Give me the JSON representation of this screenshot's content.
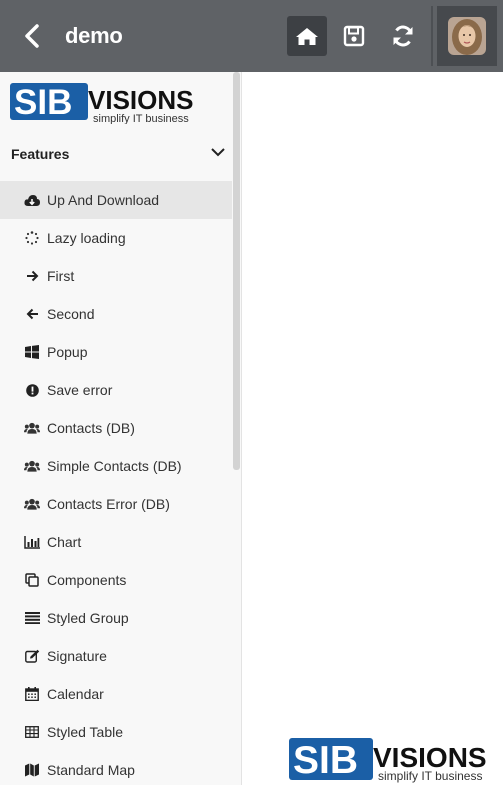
{
  "header": {
    "title": "demo",
    "back_icon": "chevron-left-icon",
    "home_icon": "home-icon",
    "save_icon": "floppy-disk-icon",
    "reload_icon": "refresh-icon",
    "avatar": "user-avatar"
  },
  "brand": {
    "name_left": "SIB",
    "name_right": "VISIONS",
    "tagline": "simplify IT business",
    "color": "#1b5fa6"
  },
  "sidebar": {
    "group_title": "Features",
    "items": [
      {
        "label": "Up And Download",
        "icon": "cloud-download-icon",
        "active": true
      },
      {
        "label": "Lazy loading",
        "icon": "spinner-icon"
      },
      {
        "label": "First",
        "icon": "arrow-right-icon"
      },
      {
        "label": "Second",
        "icon": "arrow-left-icon"
      },
      {
        "label": "Popup",
        "icon": "windows-icon"
      },
      {
        "label": "Save error",
        "icon": "exclamation-circle-icon"
      },
      {
        "label": "Contacts (DB)",
        "icon": "users-icon"
      },
      {
        "label": "Simple Contacts (DB)",
        "icon": "users-icon"
      },
      {
        "label": "Contacts Error (DB)",
        "icon": "users-icon"
      },
      {
        "label": "Chart",
        "icon": "bar-chart-icon"
      },
      {
        "label": "Components",
        "icon": "clone-icon"
      },
      {
        "label": "Styled Group",
        "icon": "list-icon"
      },
      {
        "label": "Signature",
        "icon": "edit-icon"
      },
      {
        "label": "Calendar",
        "icon": "calendar-icon"
      },
      {
        "label": "Styled Table",
        "icon": "table-icon"
      },
      {
        "label": "Standard Map",
        "icon": "map-icon"
      }
    ]
  }
}
